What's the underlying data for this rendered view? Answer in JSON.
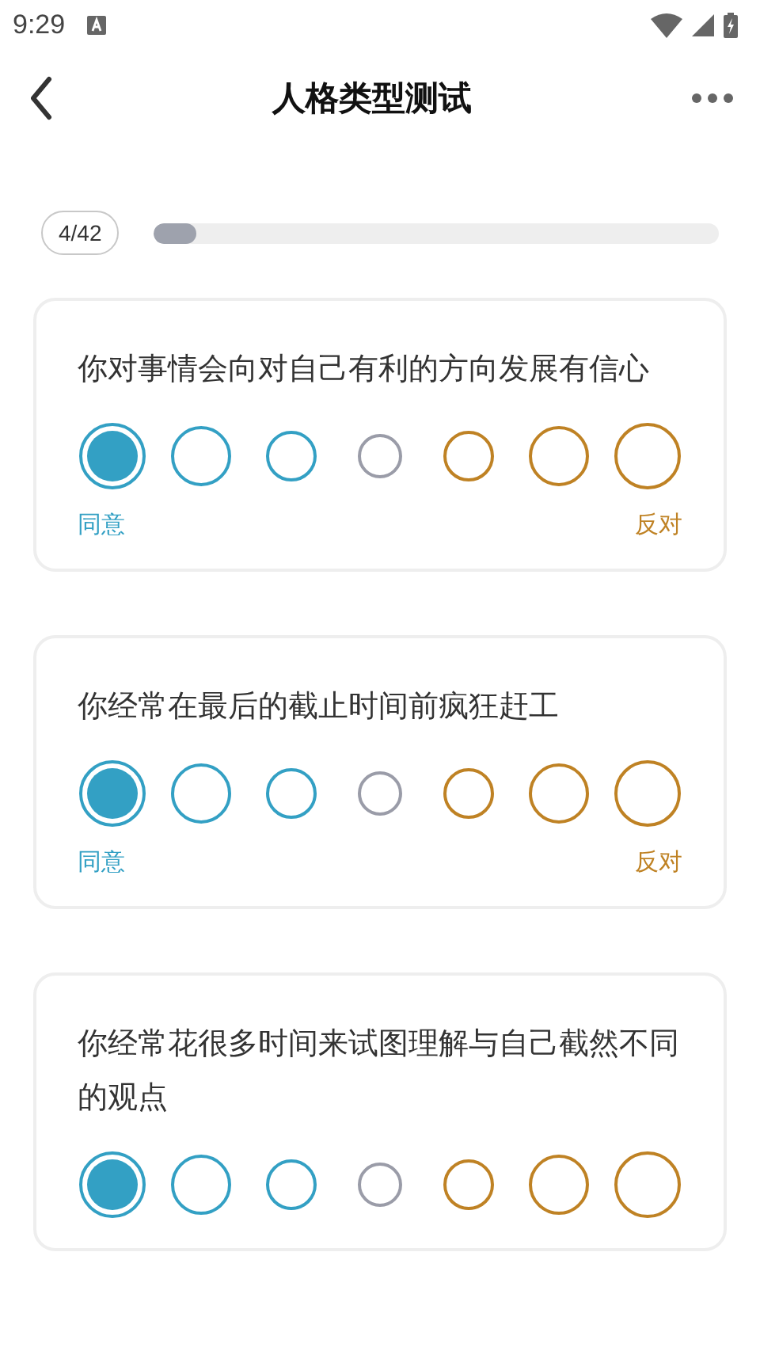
{
  "status_bar": {
    "time": "9:29"
  },
  "header": {
    "title": "人格类型测试"
  },
  "progress": {
    "count": "4/42",
    "level": 0.075
  },
  "questions": [
    {
      "text": "你对事情会向对自己有利的方向发展有信心",
      "options": [
        {
          "selected": true
        },
        {
          "selected": false
        },
        {
          "selected": false
        },
        {
          "selected": false
        },
        {
          "selected": false
        },
        {
          "selected": false
        },
        {
          "selected": false
        }
      ],
      "labels": {
        "agree": "同意",
        "disagree": "反对"
      }
    },
    {
      "text": "你经常在最后的截止时间前疯狂赶工",
      "options": [
        {
          "selected": true
        },
        {
          "selected": false
        },
        {
          "selected": false
        },
        {
          "selected": false
        },
        {
          "selected": false
        },
        {
          "selected": false
        },
        {
          "selected": false
        }
      ],
      "labels": {
        "agree": "同意",
        "disagree": "反对"
      }
    },
    {
      "text": "你经常花很多时间来试图理解与自己截然不同的观点",
      "options": [
        {
          "selected": true
        },
        {
          "selected": false
        },
        {
          "selected": false
        },
        {
          "selected": false
        },
        {
          "selected": false
        },
        {
          "selected": false
        },
        {
          "selected": false
        }
      ]
    }
  ]
}
